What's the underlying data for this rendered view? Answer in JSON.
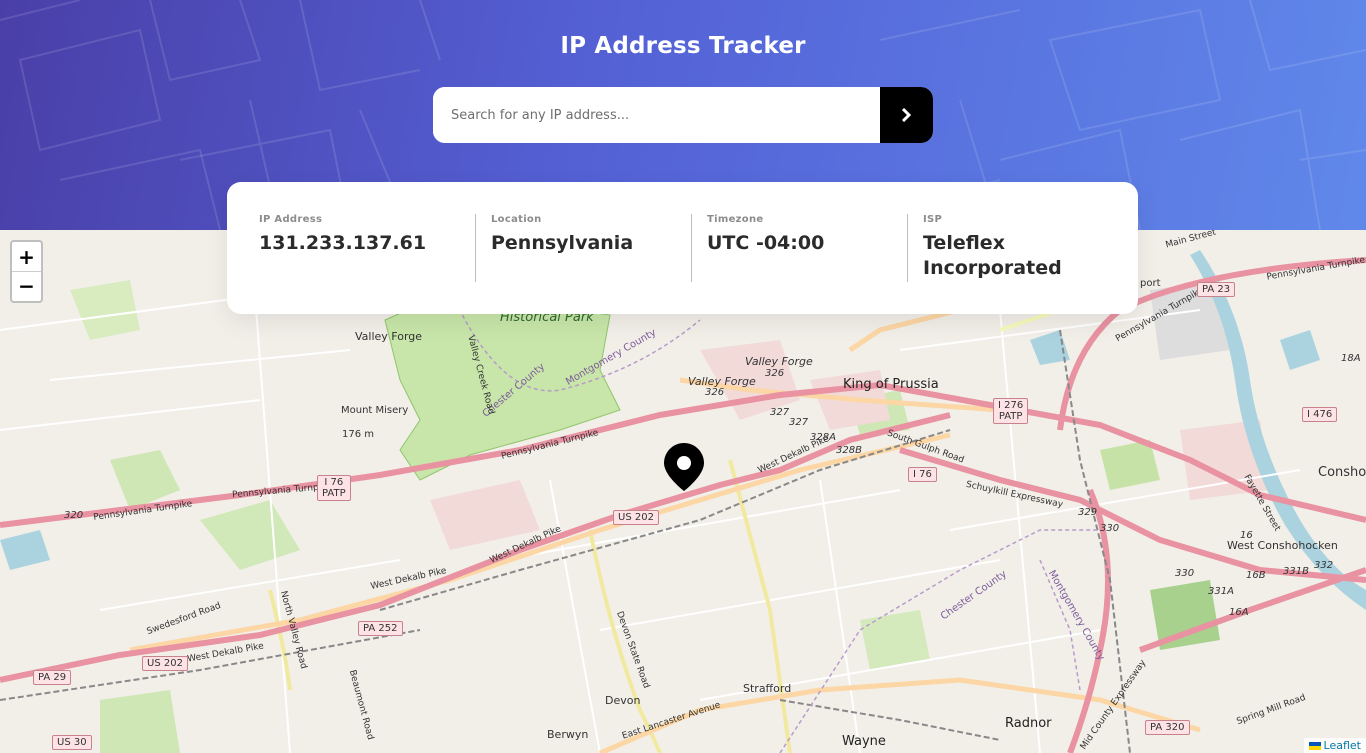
{
  "header": {
    "title": "IP Address Tracker"
  },
  "search": {
    "placeholder": "Search for any IP address...",
    "value": "",
    "submit_icon": "chevron-right-icon"
  },
  "info": {
    "ip_label": "IP Address",
    "ip_value": "131.233.137.61",
    "location_label": "Location",
    "location_value": "Pennsylvania",
    "timezone_label": "Timezone",
    "timezone_value": "UTC -04:00",
    "isp_label": "ISP",
    "isp_value": "Teleflex Incorporated"
  },
  "map": {
    "zoom_in": "+",
    "zoom_out": "−",
    "attribution": "Leaflet",
    "marker_icon": "location-pin-icon",
    "labels": {
      "historical_park": "Historical Park",
      "valley_forge_1": "Valley Forge",
      "valley_forge_2": "Valley Forge",
      "valley_forge_3": "Valley Forge",
      "king_of_prussia": "King of Prussia",
      "mount_misery": "Mount Misery",
      "elev": "176 m",
      "west_conshohocken": "West Conshohocken",
      "strafford": "Strafford",
      "devon": "Devon",
      "berwyn": "Berwyn",
      "wayne": "Wayne",
      "radnor": "Radnor",
      "consho": "Consho",
      "penn_tpk_1": "Pennsylvania Turnpike",
      "penn_tpk_2": "Pennsylvania Turnpike",
      "penn_tpk_3": "Pennsylvania Turnpike",
      "penn_tpk_4": "Pennsylvania Turnpike",
      "west_dekalb_1": "West Dekalb Pike",
      "west_dekalb_2": "West Dekalb Pike",
      "west_dekalb_3": "West Dekalb Pike",
      "west_dekalb_4": "West Dekalb Pike",
      "south_gulph": "South Gulph Road",
      "schuylkill": "Schuylkill Expressway",
      "swedesford": "Swedesford Road",
      "north_valley": "North Valley Road",
      "chester_county_1": "Chester County",
      "chester_county_2": "Chester County",
      "montgomery_1": "Montgomery County",
      "montgomery_2": "Montgomery County",
      "east_lancaster": "East Lancaster Avenue",
      "devon_state": "Devon State Road",
      "main_street": "Main Street",
      "fayette": "Fayette Street",
      "mid_county": "Mid County Expressway",
      "spring_mill": "Spring Mill Road",
      "beaumont": "Beaumont Road",
      "port": "port",
      "vf_creek": "Valley Creek Road",
      "exit_326a": "326",
      "exit_326b": "326",
      "exit_327a": "327",
      "exit_327b": "327",
      "exit_328a": "328A",
      "exit_328b": "328B",
      "exit_329": "329",
      "exit_330a": "330",
      "exit_330b": "330",
      "exit_331a": "331A",
      "exit_331b": "331B",
      "exit_332": "332",
      "exit_16a": "16A",
      "exit_16b": "16B",
      "exit_16": "16",
      "exit_18a": "18A",
      "exit_320": "320"
    },
    "shields": {
      "i76_patp_w": "I 76\nPATP",
      "i276_patp": "I 276\nPATP",
      "i76_e": "I 76",
      "i476": "I 476",
      "us202_a": "US 202",
      "us202_b": "US 202",
      "pa252": "PA 252",
      "pa29": "PA 29",
      "us30": "US 30",
      "pa23": "PA 23",
      "pa320": "PA 320"
    }
  }
}
